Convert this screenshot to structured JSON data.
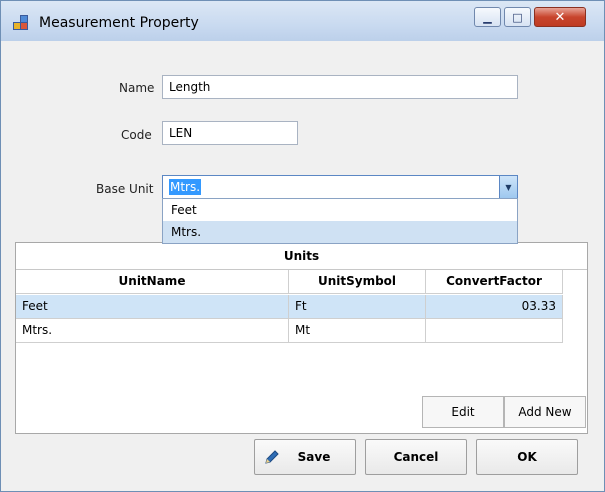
{
  "window": {
    "title": "Measurement Property",
    "min_glyph": "▁",
    "max_glyph": "□",
    "close_glyph": "✕"
  },
  "form": {
    "name_label": "Name",
    "name_value": "Length",
    "code_label": "Code",
    "code_value": "LEN",
    "base_unit_label": "Base Unit",
    "base_unit_value": "Mtrs.",
    "base_unit_options": [
      "Feet",
      "Mtrs."
    ],
    "dropdown_arrow": "▼"
  },
  "grid": {
    "caption": "Units",
    "columns": [
      "UnitName",
      "UnitSymbol",
      "ConvertFactor"
    ],
    "rows": [
      {
        "name": "Feet",
        "symbol": "Ft",
        "factor": "03.33"
      },
      {
        "name": "Mtrs.",
        "symbol": "Mt",
        "factor": ""
      }
    ]
  },
  "buttons": {
    "edit": "Edit",
    "add_new": "Add New",
    "save": "Save",
    "cancel": "Cancel",
    "ok": "OK"
  },
  "colors": {
    "selection": "#3399ff",
    "row_highlight": "#cfe4f7",
    "close_button": "#c8452d"
  }
}
